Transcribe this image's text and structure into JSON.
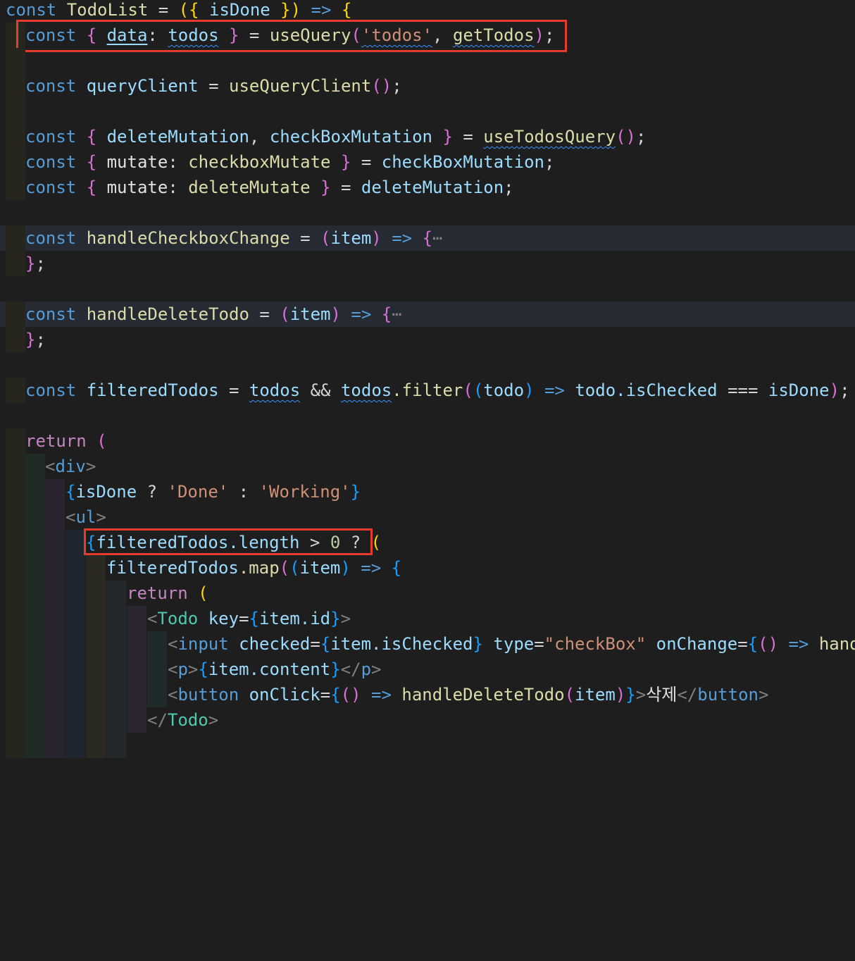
{
  "code": {
    "l1": {
      "a": "const",
      "b": "TodoList",
      "c": "=",
      "d": "({",
      "e": "isDone",
      "f": "})",
      "g": "=>",
      "h": "{"
    },
    "l2": {
      "a": "const",
      "b": "{",
      "c": "data",
      "d": ":",
      "e": "todos",
      "f": "}",
      "g": "=",
      "h": "useQuery",
      "i": "(",
      "j": "'todos'",
      "k": ",",
      "l": "getTodos",
      "m": ")",
      "n": ";"
    },
    "l4": {
      "a": "const",
      "b": "queryClient",
      "c": "=",
      "d": "useQueryClient",
      "e": "()",
      "f": ";"
    },
    "l6": {
      "a": "const",
      "b": "{",
      "c": "deleteMutation",
      "d": ",",
      "e": "checkBoxMutation",
      "f": "}",
      "g": "=",
      "h": "useTodosQuery",
      "i": "()",
      "j": ";"
    },
    "l7": {
      "a": "const",
      "b": "{",
      "c": "mutate",
      "d": ":",
      "e": "checkboxMutate",
      "f": "}",
      "g": "=",
      "h": "checkBoxMutation",
      "i": ";"
    },
    "l8": {
      "a": "const",
      "b": "{",
      "c": "mutate",
      "d": ":",
      "e": "deleteMutate",
      "f": "}",
      "g": "=",
      "h": "deleteMutation",
      "i": ";"
    },
    "l10": {
      "a": "const",
      "b": "handleCheckboxChange",
      "c": "=",
      "d": "(",
      "e": "item",
      "f": ")",
      "g": "=>",
      "h": "{",
      "i": "⋯"
    },
    "l11": {
      "a": "}",
      "b": ";"
    },
    "l13": {
      "a": "const",
      "b": "handleDeleteTodo",
      "c": "=",
      "d": "(",
      "e": "item",
      "f": ")",
      "g": "=>",
      "h": "{",
      "i": "⋯"
    },
    "l14": {
      "a": "}",
      "b": ";"
    },
    "l16": {
      "a": "const",
      "b": "filteredTodos",
      "c": "=",
      "d": "todos",
      "e": "&&",
      "f": "todos",
      "g": ".filter",
      "h": "(",
      "i": "(",
      "j": "todo",
      "k": ")",
      "l": "=>",
      "m": "todo.isChecked",
      "n": "===",
      "o": "isDone",
      "p": ")",
      "q": ";"
    },
    "l18": {
      "a": "return",
      "b": "("
    },
    "l19": {
      "a": "<",
      "b": "div",
      "c": ">"
    },
    "l20": {
      "a": "{",
      "b": "isDone",
      "c": "?",
      "d": "'Done'",
      "e": ":",
      "f": "'Working'",
      "g": "}"
    },
    "l21": {
      "a": "<",
      "b": "ul",
      "c": ">"
    },
    "l22": {
      "a": "{",
      "b": "filteredTodos",
      "c": ".length",
      "d": ">",
      "e": "0",
      "f": "?",
      "g": "("
    },
    "l23": {
      "a": "filteredTodos",
      "b": ".map",
      "c": "(",
      "d": "(",
      "e": "item",
      "f": ")",
      "g": "=>",
      "h": "{"
    },
    "l24": {
      "a": "return",
      "b": "("
    },
    "l25": {
      "a": "<",
      "b": "Todo",
      "c": "key",
      "d": "=",
      "e": "{",
      "f": "item.id",
      "g": "}",
      "h": ">"
    },
    "l26": {
      "a": "<",
      "b": "input",
      "c": "checked",
      "d": "=",
      "e": "{",
      "f": "item.isChecked",
      "g": "}",
      "h": "type",
      "i": "=",
      "j": "\"checkBox\"",
      "k": "onChange",
      "l": "=",
      "m": "{",
      "n": "()",
      "o": "=>",
      "p": "hand"
    },
    "l27": {
      "a": "<",
      "b": "p",
      "c": ">",
      "d": "{",
      "e": "item.content",
      "f": "}",
      "g": "</",
      "h": "p",
      "i": ">"
    },
    "l28": {
      "a": "<",
      "b": "button",
      "c": "onClick",
      "d": "=",
      "e": "{",
      "f": "()",
      "g": "=>",
      "h": "handleDeleteTodo",
      "i": "(",
      "j": "item",
      "k": ")",
      "l": "}",
      "m": ">",
      "n": "삭제",
      "o": "</",
      "p": "button",
      "q": ">"
    },
    "l29": {
      "a": "</",
      "b": "Todo",
      "c": ">"
    }
  },
  "colors": {
    "background": "#1e1e1e",
    "keyword": "#569cd6",
    "identifier": "#9cdcfe",
    "function": "#dcdcaa",
    "string": "#ce9178",
    "highlight_box": "#e53c2e"
  }
}
